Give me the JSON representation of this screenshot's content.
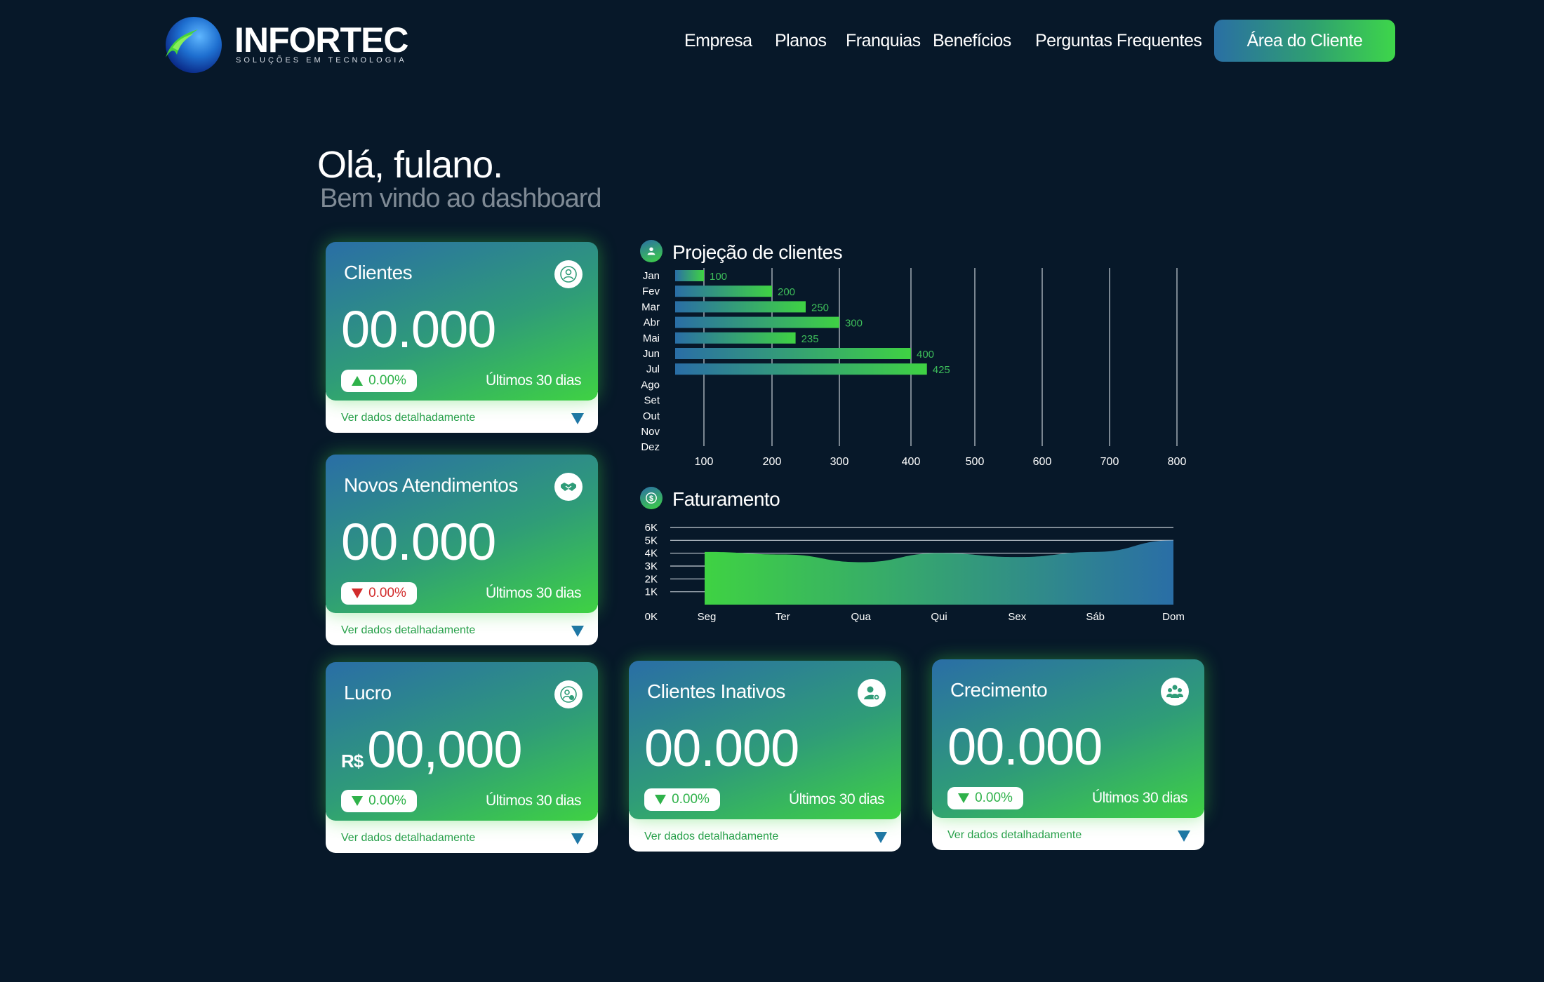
{
  "brand": {
    "name": "INFORTEC",
    "tagline": "SOLUÇÕES EM TECNOLOGIA"
  },
  "nav": {
    "items": [
      "Empresa",
      "Planos",
      "Franquias",
      "Benefícios",
      "Perguntas Frequentes"
    ],
    "cta": "Área do Cliente"
  },
  "greeting": {
    "title": "Olá, fulano.",
    "subtitle": "Bem vindo ao dashboard"
  },
  "cards": [
    {
      "title": "Clientes",
      "icon": "user-circle-icon",
      "currency": "",
      "value": "00.000",
      "change": "0.00%",
      "trend": "up",
      "period": "Últimos 30 dias",
      "detail": "Ver dados detalhadamente"
    },
    {
      "title": "Novos Atendimentos",
      "icon": "handshake-icon",
      "currency": "",
      "value": "00.000",
      "change": "0.00%",
      "trend": "down-red",
      "period": "Últimos 30 dias",
      "detail": "Ver dados detalhadamente"
    },
    {
      "title": "Lucro",
      "icon": "user-money-icon",
      "currency": "R$",
      "value": "00,000",
      "change": "0.00%",
      "trend": "down",
      "period": "Últimos 30 dias",
      "detail": "Ver dados detalhadamente"
    },
    {
      "title": "Clientes Inativos",
      "icon": "user-settings-icon",
      "currency": "",
      "value": "00.000",
      "change": "0.00%",
      "trend": "down",
      "period": "Últimos 30 dias",
      "detail": "Ver dados detalhadamente"
    },
    {
      "title": "Crecimento",
      "icon": "group-icon",
      "currency": "",
      "value": "00.000",
      "change": "0.00%",
      "trend": "down",
      "period": "Últimos 30 dias",
      "detail": "Ver dados detalhadamente"
    }
  ],
  "chart_data": [
    {
      "type": "bar",
      "orientation": "horizontal",
      "title": "Projeção de clientes",
      "icon": "users-icon",
      "categories": [
        "Jan",
        "Fev",
        "Mar",
        "Abr",
        "Mai",
        "Jun",
        "Jul",
        "Ago",
        "Set",
        "Out",
        "Nov",
        "Dez"
      ],
      "values": [
        100,
        200,
        250,
        300,
        235,
        400,
        425,
        null,
        null,
        null,
        null,
        null
      ],
      "x_ticks": [
        100,
        200,
        300,
        400,
        500,
        600,
        700,
        800
      ],
      "grid": true,
      "colors": {
        "bar_start": "#2a6ea6",
        "bar_end": "#3fd243",
        "label": "#3dbd5a"
      }
    },
    {
      "type": "area",
      "title": "Faturamento",
      "icon": "dollar-icon",
      "categories": [
        "Seg",
        "Ter",
        "Qua",
        "Qui",
        "Sex",
        "Sáb",
        "Dom"
      ],
      "values": [
        4100,
        3900,
        3300,
        4000,
        3700,
        4100,
        5000
      ],
      "y_ticks": [
        "0K",
        "1K",
        "2K",
        "3K",
        "4K",
        "5K",
        "6K"
      ],
      "ylim": [
        0,
        6000
      ],
      "grid": true,
      "colors": {
        "area_start": "#3fd243",
        "area_end": "#2a6ea6"
      }
    }
  ]
}
